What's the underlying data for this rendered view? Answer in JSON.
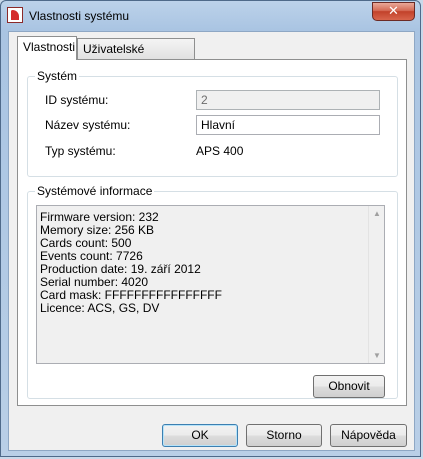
{
  "window": {
    "title": "Vlastnosti systému",
    "close_glyph": "✕"
  },
  "tabs": [
    {
      "label": "Vlastnosti",
      "active": true
    },
    {
      "label": "Uživatelské události",
      "active": false
    }
  ],
  "system_group": {
    "legend": "Systém",
    "id_label": "ID systému:",
    "id_value": "2",
    "name_label": "Název systému:",
    "name_value": "Hlavní",
    "type_label": "Typ systému:",
    "type_value": "APS 400"
  },
  "info_group": {
    "legend": "Systémové informace",
    "lines": [
      "Firmware version: 232",
      "Memory size: 256 KB",
      "Cards count: 500",
      "Events count: 7726",
      "Production date: 19. září 2012",
      "Serial number: 4020",
      "Card mask: FFFFFFFFFFFFFFFF",
      "Licence: ACS, GS, DV"
    ],
    "scroll_up": "▲",
    "scroll_down": "▼",
    "refresh_label": "Obnovit"
  },
  "footer": {
    "ok_label": "OK",
    "cancel_label": "Storno",
    "help_label": "Nápověda"
  }
}
